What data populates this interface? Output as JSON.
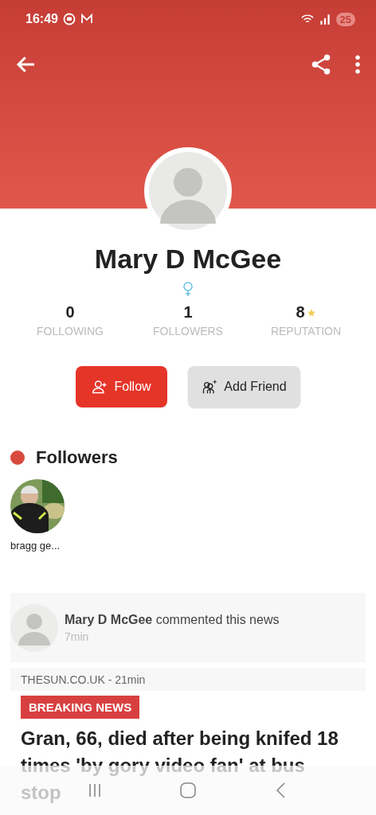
{
  "status_bar": {
    "time": "16:49",
    "battery": "25"
  },
  "profile": {
    "name": "Mary D McGee"
  },
  "stats": [
    {
      "value": "0",
      "label": "FOLLOWING",
      "kind": "count"
    },
    {
      "value": "1",
      "label": "FOLLOWERS",
      "kind": "count"
    },
    {
      "value": "8",
      "label": "REPUTATION",
      "kind": "rating"
    }
  ],
  "buttons": [
    {
      "label": "Follow",
      "kind": "primary"
    },
    {
      "label": "Add Friend",
      "kind": "secondary"
    }
  ],
  "followers_section": {
    "title": "Followers",
    "followers": [
      {
        "name": "bragg ge...",
        "kind": "picture"
      }
    ]
  },
  "activity": {
    "text": "**Mary D McGee** commented this news",
    "time": "7min"
  },
  "news": {
    "source": "THESUN.CO.UK - 21min",
    "badge": "BREAKING NEWS",
    "headline": "Gran, 66, died after being knifed 18 times 'by gory video fan' at bus stop"
  }
}
